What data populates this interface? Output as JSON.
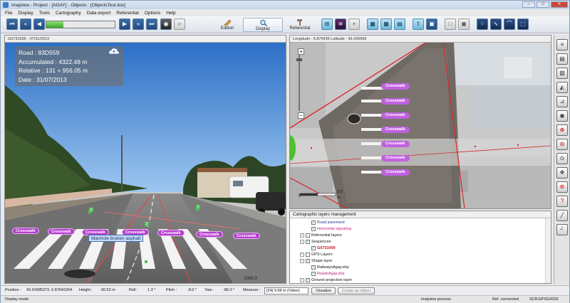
{
  "window": {
    "title": "imajview - Project : [AGAY] - Objects : [ObjectsTest.iiox]",
    "controls": [
      "–",
      "□",
      "✕"
    ]
  },
  "menu": [
    "File",
    "Display",
    "Tools",
    "Cartography",
    "Data export",
    "Referential",
    "Options",
    "Help"
  ],
  "toolbar": {
    "progress_fraction": 0.25,
    "edition_label": "Edition",
    "display_label": "Display",
    "referential_label": "Referential"
  },
  "left_panel": {
    "header": "G0731000 - 07/31/2013",
    "info": {
      "road": "Road : 83D559",
      "accumulated": "Accumulated : 4322.48 m",
      "relative": "Relative : 131 + 956.05 m",
      "date": "Date : 31/07/2013"
    },
    "crosswalk_label": "Crosswalk",
    "manhole_label": "Manhole broken asphalt",
    "frame_value": "2380,9",
    "badge_values": [
      "2",
      "1",
      "1",
      "2"
    ]
  },
  "map_panel": {
    "header": "Longitude : 6.876439 Latitude : 43.426908",
    "crosswalk_label": "Crosswalk",
    "scale_zero": "0",
    "scale_max": "2.5",
    "scale_unit": "m",
    "zoom_in": "+",
    "zoom_out": "−"
  },
  "layers_panel": {
    "title": "Cartographic layers management",
    "items": [
      {
        "label": "Road pavement",
        "indent": 2,
        "checked": true,
        "color": "#1b3a9c"
      },
      {
        "label": "Horizontal signaling",
        "indent": 2,
        "checked": true,
        "color": "#c0207a"
      },
      {
        "label": "Referential layers",
        "indent": 1,
        "checked": false,
        "color": "#111111"
      },
      {
        "label": "Sequences",
        "indent": 1,
        "checked": true,
        "color": "#111111"
      },
      {
        "label": "G0731000",
        "indent": 2,
        "checked": true,
        "color": "#c4121b"
      },
      {
        "label": "GPS Layers",
        "indent": 1,
        "checked": false,
        "color": "#111111"
      },
      {
        "label": "Shape layer",
        "indent": 1,
        "checked": true,
        "color": "#111111"
      },
      {
        "label": "RailwaysAgay.shp",
        "indent": 2,
        "checked": true,
        "color": "#111111"
      },
      {
        "label": "RoadsAgay.shp",
        "indent": 2,
        "checked": true,
        "color": "#c0207a"
      },
      {
        "label": "Ground projection layer",
        "indent": 1,
        "checked": true,
        "color": "#111111"
      }
    ]
  },
  "status": {
    "position_label": "Position :",
    "position_value": "43.42685373, 6.87642264",
    "height_label": "Height :",
    "height_value": "60.52 m",
    "roll_label": "Roll :",
    "roll_value": "1.3 °",
    "pitch_label": "Pitch :",
    "pitch_value": "-8.0 °",
    "yaw_label": "Yaw :",
    "yaw_value": "-86.0 °",
    "measure_label": "Measure :",
    "measure_value": "[24] 9.98 m (Video)",
    "visualize_label": "Visualize",
    "create_label": "Create an object",
    "mode": "Display mode",
    "process": "imajview process",
    "ref": "Ref. connected",
    "code": "SCR:EPSG4326"
  }
}
